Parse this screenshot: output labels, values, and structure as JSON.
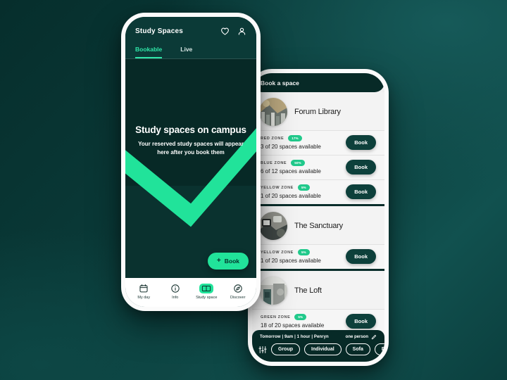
{
  "left_phone": {
    "header": {
      "title": "Study Spaces",
      "heart_icon": "heart-icon",
      "profile_icon": "profile-icon"
    },
    "tabs": [
      {
        "label": "Bookable",
        "active": true
      },
      {
        "label": "Live",
        "active": false
      }
    ],
    "hero": {
      "heading": "Study spaces on campus",
      "subtext": "Your reserved study spaces will appear here after you book them"
    },
    "fab": {
      "plus": "+",
      "label": "Book"
    },
    "nav": [
      {
        "label": "My day",
        "icon": "calendar-icon",
        "selected": false
      },
      {
        "label": "Info",
        "icon": "info-icon",
        "selected": false
      },
      {
        "label": "Study space",
        "icon": "book-open-icon",
        "selected": true
      },
      {
        "label": "Discover",
        "icon": "compass-icon",
        "selected": false
      }
    ]
  },
  "right_phone": {
    "header": {
      "title": "Book a space"
    },
    "spaces": [
      {
        "name": "Forum Library",
        "zones": [
          {
            "name": "RED ZONE",
            "badge": "17%",
            "availability": "3 of 20 spaces available",
            "book_label": "Book"
          },
          {
            "name": "BLUE ZONE",
            "badge": "50%",
            "availability": "6 of 12 spaces available",
            "book_label": "Book"
          },
          {
            "name": "YELLOW ZONE",
            "badge": "5%",
            "availability": "1 of 20 spaces available",
            "book_label": "Book"
          }
        ]
      },
      {
        "name": "The Sanctuary",
        "zones": [
          {
            "name": "YELLOW ZONE",
            "badge": "5%",
            "availability": "1 of 20 spaces available",
            "book_label": "Book"
          }
        ]
      },
      {
        "name": "The Loft",
        "zones": [
          {
            "name": "GREEN ZONE",
            "badge": "5%",
            "availability": "18 of 20 spaces available",
            "book_label": "Book"
          }
        ]
      }
    ],
    "bottom_sheet": {
      "when": "Tomorrow | 9am | 1 hour | Penryn",
      "party": "one person",
      "edit_icon": "pencil-icon",
      "filter_icon": "filter-icon",
      "chips": [
        "Group",
        "Individual",
        "Sofa",
        "Power"
      ]
    }
  },
  "colors": {
    "accent_mint": "#21e39a",
    "dark_teal": "#072a27",
    "badge_green": "#21c98b"
  }
}
